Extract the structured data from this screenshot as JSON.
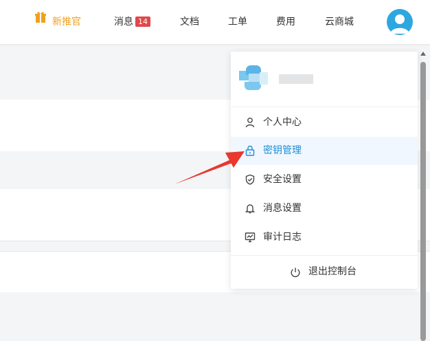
{
  "topnav": {
    "promo_label": "新推官",
    "messages_label": "消息",
    "messages_count": "14",
    "docs_label": "文档",
    "tickets_label": "工单",
    "billing_label": "费用",
    "store_label": "云商城"
  },
  "account_menu": {
    "items": [
      {
        "label": "个人中心",
        "icon": "user-icon"
      },
      {
        "label": "密钥管理",
        "icon": "lock-icon",
        "active": true
      },
      {
        "label": "安全设置",
        "icon": "shield-check-icon"
      },
      {
        "label": "消息设置",
        "icon": "bell-icon"
      },
      {
        "label": "审计日志",
        "icon": "monitor-chart-icon"
      }
    ],
    "logout_label": "退出控制台"
  },
  "colors": {
    "accent": "#1a8fd6",
    "promo": "#f0a020",
    "badge": "#e0474b",
    "annotation_arrow": "#e8382f"
  }
}
